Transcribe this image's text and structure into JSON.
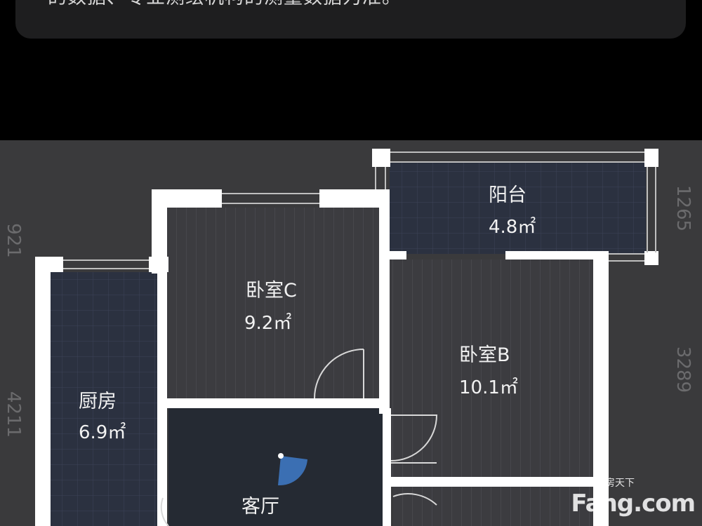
{
  "notice": {
    "text": "的数据、专业测绘机构的测量数据为准。"
  },
  "rooms": {
    "balcony": {
      "name": "阳台",
      "area": "4.8㎡"
    },
    "bedroom_c": {
      "name": "卧室C",
      "area": "9.2㎡"
    },
    "bedroom_b": {
      "name": "卧室B",
      "area": "10.1㎡"
    },
    "kitchen": {
      "name": "厨房",
      "area": "6.9㎡"
    },
    "living": {
      "name": "客厅",
      "area": ""
    }
  },
  "dimensions": {
    "left_top": "921",
    "left_bottom": "4211",
    "right_top": "1265",
    "right_middle": "3289"
  },
  "watermark": {
    "brand": "Fang.com",
    "tagline": "房天下"
  },
  "colors": {
    "background": "#000000",
    "plan_background": "#3a3a3c",
    "wall": "#ffffff",
    "tile_floor": "#2b3140",
    "wood_floor": "#3c3c40",
    "living_floor": "#252a33"
  }
}
